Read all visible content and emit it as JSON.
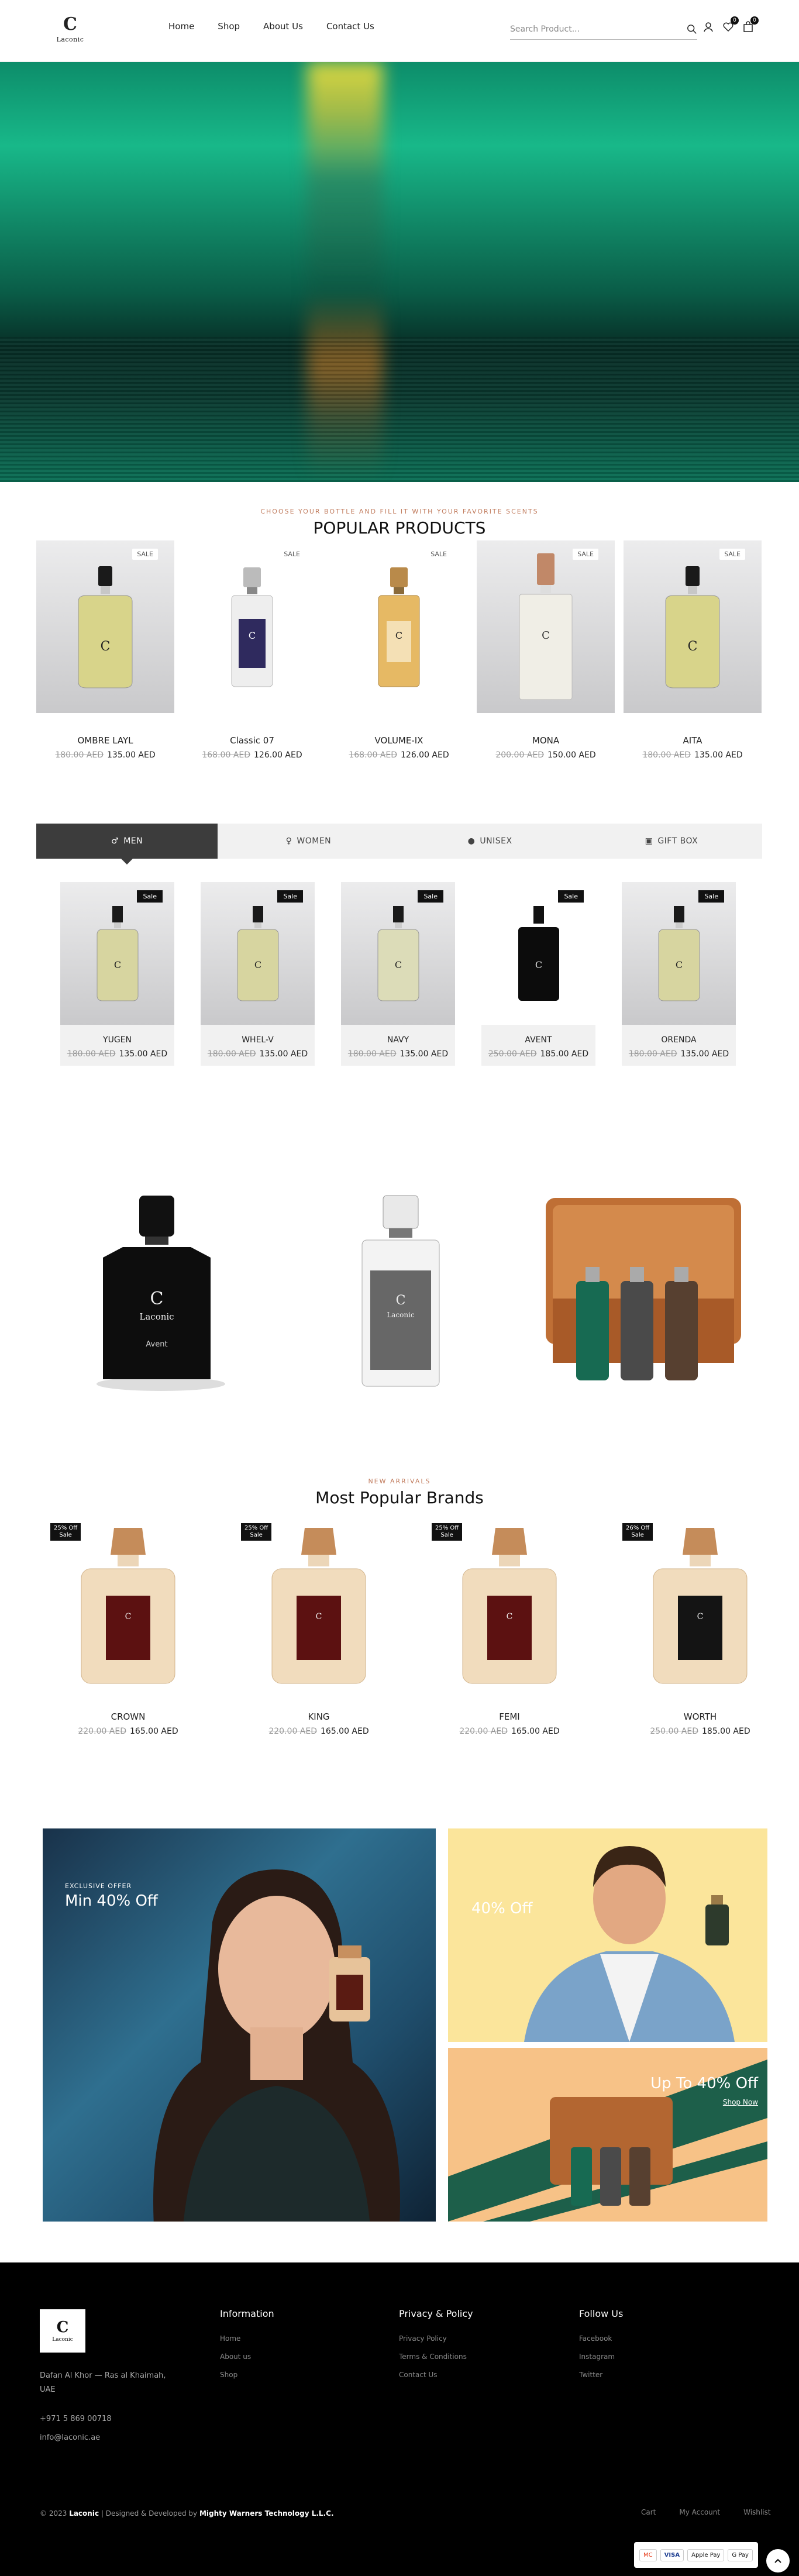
{
  "brand": {
    "name": "Laconic",
    "mark": "C"
  },
  "nav": [
    "Home",
    "Shop",
    "About Us",
    "Contact Us"
  ],
  "search": {
    "placeholder": "Search Product..."
  },
  "header_icons": {
    "wishlist_count": "0",
    "cart_count": "0"
  },
  "popular": {
    "eyebrow": "CHOOSE YOUR BOTTLE AND FILL IT WITH YOUR FAVORITE SCENTS",
    "title": "POPULAR PRODUCTS",
    "products": [
      {
        "name": "OMBRE LAYL",
        "old": "180.00 AED",
        "price": "135.00 AED",
        "sale": "SALE"
      },
      {
        "name": "Classic 07",
        "old": "168.00 AED",
        "price": "126.00 AED",
        "sale": "SALE"
      },
      {
        "name": "VOLUME-IX",
        "old": "168.00 AED",
        "price": "126.00 AED",
        "sale": "SALE"
      },
      {
        "name": "MONA",
        "old": "200.00 AED",
        "price": "150.00 AED",
        "sale": "SALE"
      },
      {
        "name": "AITA",
        "old": "180.00 AED",
        "price": "135.00 AED",
        "sale": "SALE"
      }
    ]
  },
  "tabs": [
    "MEN",
    "WOMEN",
    "UNISEX",
    "GIFT BOX"
  ],
  "men_products": [
    {
      "name": "YUGEN",
      "old": "180.00 AED",
      "price": "135.00 AED",
      "sale": "Sale"
    },
    {
      "name": "WHEL-V",
      "old": "180.00 AED",
      "price": "135.00 AED",
      "sale": "Sale"
    },
    {
      "name": "NAVY",
      "old": "180.00 AED",
      "price": "135.00 AED",
      "sale": "Sale"
    },
    {
      "name": "AVENT",
      "old": "250.00 AED",
      "price": "185.00 AED",
      "sale": "Sale"
    },
    {
      "name": "ORENDA",
      "old": "180.00 AED",
      "price": "135.00 AED",
      "sale": "Sale"
    }
  ],
  "banners": {
    "avent_label": "Avent"
  },
  "brands": {
    "eyebrow": "NEW ARRIVALS",
    "title": "Most Popular Brands",
    "items": [
      {
        "name": "CROWN",
        "old": "220.00 AED",
        "price": "165.00 AED",
        "off": "25% Off",
        "sale": "Sale"
      },
      {
        "name": "KING",
        "old": "220.00 AED",
        "price": "165.00 AED",
        "off": "25% Off",
        "sale": "Sale"
      },
      {
        "name": "FEMI",
        "old": "220.00 AED",
        "price": "165.00 AED",
        "off": "25% Off",
        "sale": "Sale"
      },
      {
        "name": "WORTH",
        "old": "250.00 AED",
        "price": "185.00 AED",
        "off": "26% Off",
        "sale": "Sale"
      }
    ]
  },
  "offers": {
    "big": {
      "eyebrow": "EXCLUSIVE OFFER",
      "title": "Min 40% Off"
    },
    "top_right": {
      "title": "40% Off"
    },
    "bottom_right": {
      "title": "Up To 40% Off",
      "cta": "Shop Now"
    }
  },
  "footer": {
    "address": "Dafan Al Khor — Ras al Khaimah, UAE",
    "phone": "+971 5 869 00718",
    "email": "info@laconic.ae",
    "columns": [
      {
        "title": "Information",
        "links": [
          "Home",
          "About us",
          "Shop"
        ]
      },
      {
        "title": "Privacy & Policy",
        "links": [
          "Privacy Policy",
          "Terms & Conditions",
          "Contact Us"
        ]
      },
      {
        "title": "Follow Us",
        "links": [
          "Facebook",
          "Instagram",
          "Twitter"
        ]
      }
    ],
    "copyright_prefix": "© 2023",
    "copyright_brand": "Laconic",
    "copyright_mid": "| Designed & Developed by",
    "copyright_company": "Mighty Warners Technology L.L.C.",
    "bottom_links": [
      "Cart",
      "My Account",
      "Wishlist"
    ],
    "payments": [
      "MC",
      "VISA",
      "Apple Pay",
      "G Pay"
    ]
  },
  "colors": {
    "accent": "#c17c5e",
    "hero": "#0d8d6a",
    "footer": "#000000",
    "tab_active": "#3c3c3c"
  }
}
